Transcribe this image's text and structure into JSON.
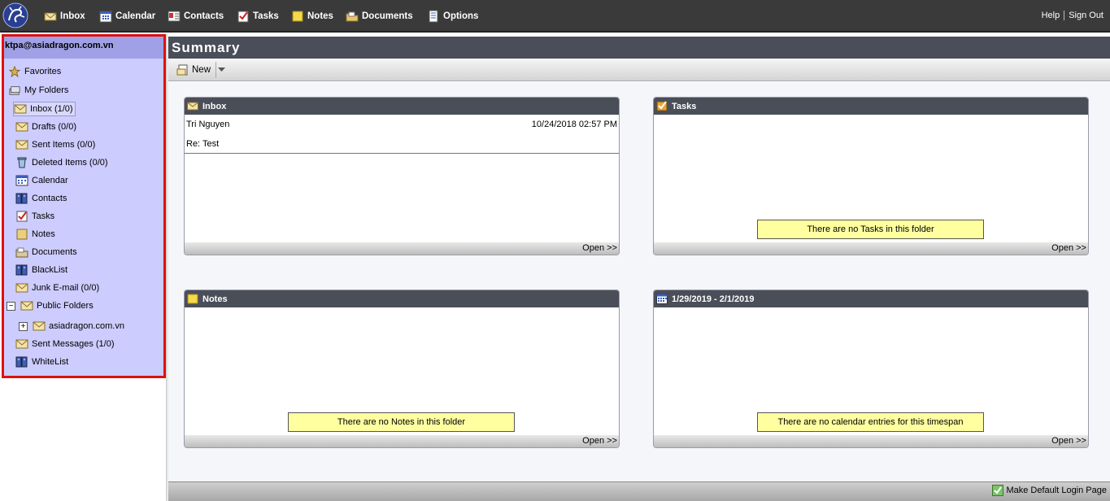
{
  "topnav": {
    "items": [
      {
        "label": "Inbox",
        "icon": "envelope-icon"
      },
      {
        "label": "Calendar",
        "icon": "calendar-icon"
      },
      {
        "label": "Contacts",
        "icon": "contacts-icon"
      },
      {
        "label": "Tasks",
        "icon": "tasks-icon"
      },
      {
        "label": "Notes",
        "icon": "notes-icon"
      },
      {
        "label": "Documents",
        "icon": "documents-icon"
      },
      {
        "label": "Options",
        "icon": "options-icon"
      }
    ],
    "help": "Help",
    "signout": "Sign Out"
  },
  "sidebar": {
    "account": "ktpa@asiadragon.com.vn",
    "favorites": "Favorites",
    "my_folders": "My Folders",
    "folders": [
      {
        "label": "Inbox (1/0)",
        "icon": "envelope-icon"
      },
      {
        "label": "Drafts (0/0)",
        "icon": "envelope-icon"
      },
      {
        "label": "Sent Items (0/0)",
        "icon": "envelope-icon"
      },
      {
        "label": "Deleted Items (0/0)",
        "icon": "trash-icon"
      },
      {
        "label": "Calendar",
        "icon": "calendar-icon"
      },
      {
        "label": "Contacts",
        "icon": "contacts-book-icon"
      },
      {
        "label": "Tasks",
        "icon": "tasks-icon"
      },
      {
        "label": "Notes",
        "icon": "notes-icon"
      },
      {
        "label": "Documents",
        "icon": "documents-icon"
      },
      {
        "label": "BlackList",
        "icon": "contacts-book-icon"
      },
      {
        "label": "Junk E-mail (0/0)",
        "icon": "envelope-icon"
      }
    ],
    "public_folders": "Public Folders",
    "public_toggle": "−",
    "domain_toggle": "+",
    "domain": "asiadragon.com.vn",
    "sent_messages": "Sent Messages (1/0)",
    "whitelist": "WhiteList"
  },
  "main": {
    "title": "Summary",
    "new_label": "New"
  },
  "panels": {
    "inbox": {
      "title": "Inbox",
      "sender": "Tri Nguyen",
      "date": "10/24/2018 02:57 PM",
      "subject": "Re: Test",
      "open": "Open >>"
    },
    "tasks": {
      "title": "Tasks",
      "empty": "There are no Tasks in this folder",
      "open": "Open >>"
    },
    "notes": {
      "title": "Notes",
      "empty": "There are no Notes in this folder",
      "open": "Open >>"
    },
    "calendar": {
      "title": "1/29/2019 - 2/1/2019",
      "empty": "There are no calendar entries for this timespan",
      "open": "Open >>"
    }
  },
  "footer": {
    "make_default": "Make Default Login Page"
  },
  "colors": {
    "topbar": "#3a3a3a",
    "sidebar": "#ccccff",
    "sidebar_border": "#e01010",
    "panel_header": "#4a4e59",
    "empty_msg": "#ffffa0"
  }
}
